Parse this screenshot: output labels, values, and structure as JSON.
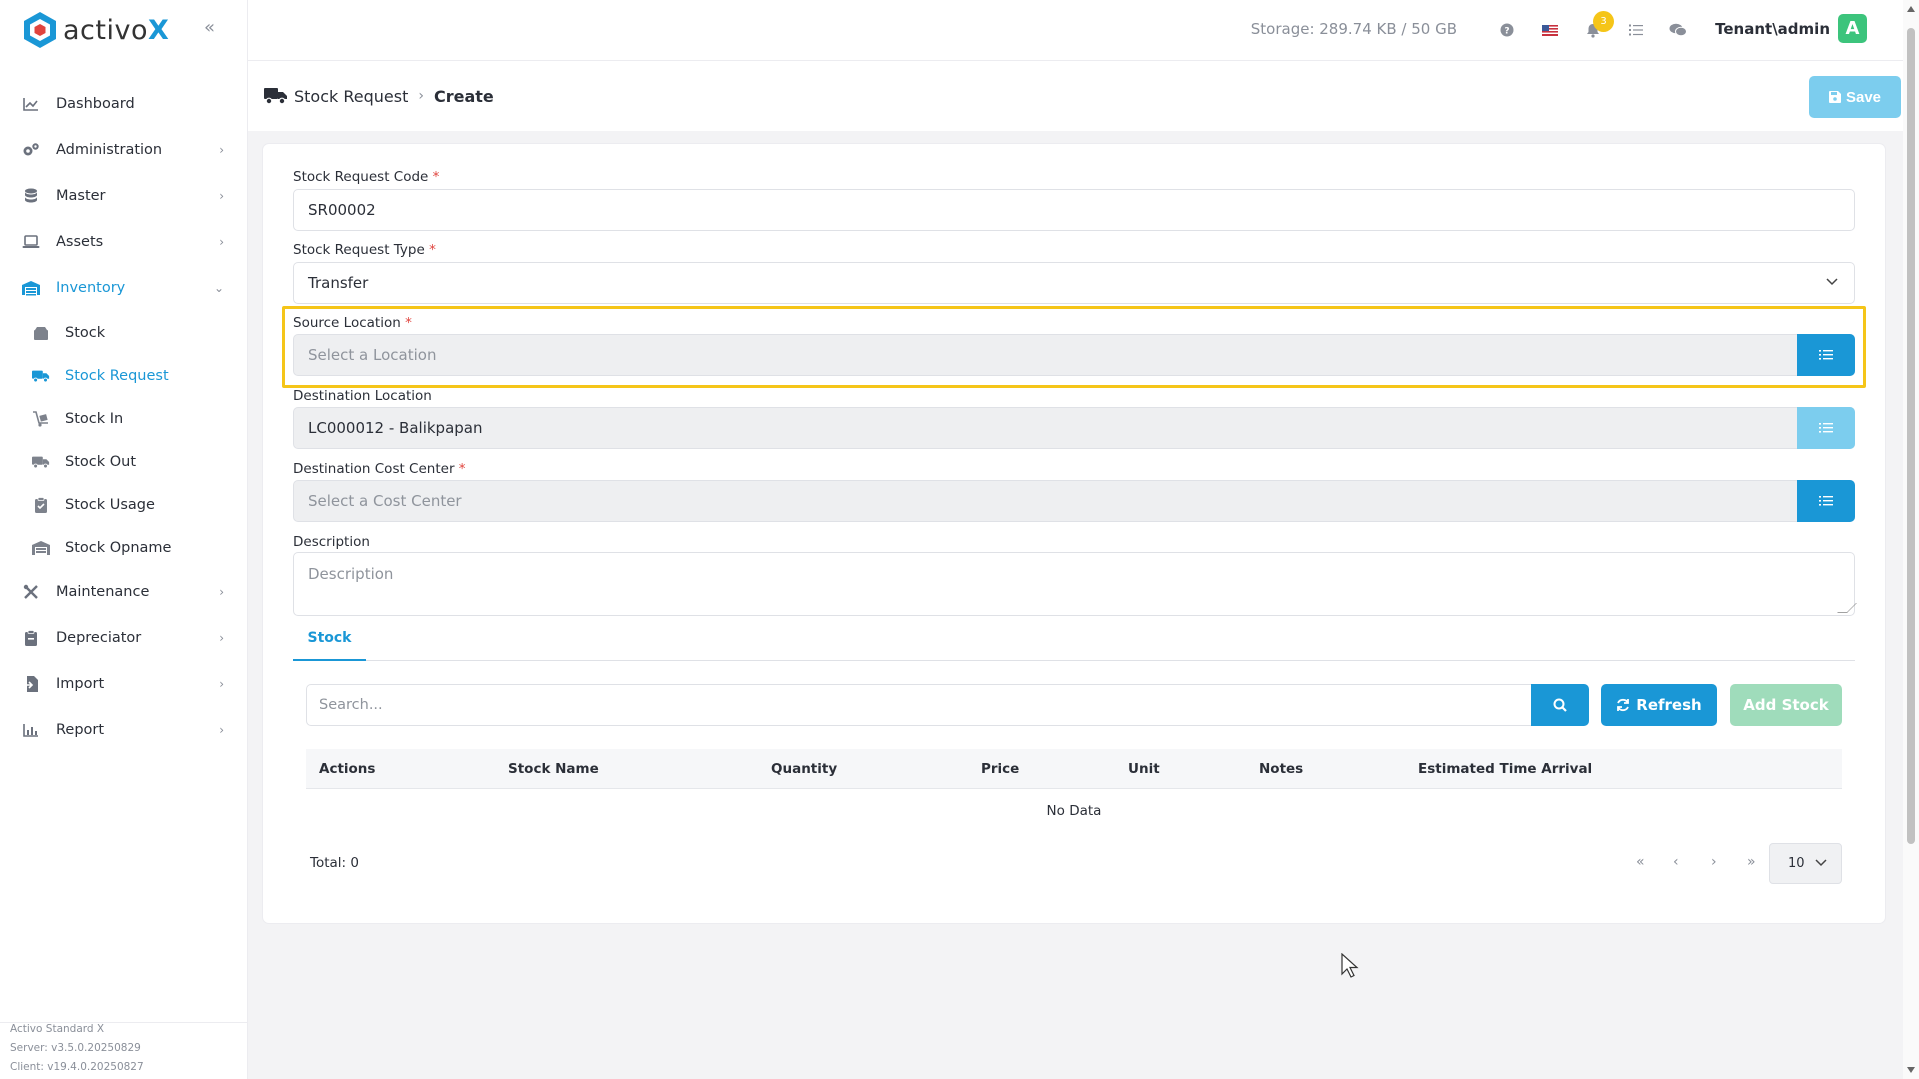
{
  "app": {
    "logo_text": "activo",
    "logo_x": "X"
  },
  "sidebar": {
    "items": [
      {
        "label": "Dashboard",
        "icon": "chart-line-icon"
      },
      {
        "label": "Administration",
        "icon": "cogs-icon",
        "has_children": true
      },
      {
        "label": "Master",
        "icon": "database-icon",
        "has_children": true
      },
      {
        "label": "Assets",
        "icon": "laptop-icon",
        "has_children": true
      },
      {
        "label": "Inventory",
        "icon": "warehouse-icon",
        "has_children": true,
        "expanded": true,
        "active": true
      },
      {
        "label": "Maintenance",
        "icon": "tools-icon",
        "has_children": true
      },
      {
        "label": "Depreciator",
        "icon": "clipboard-icon",
        "has_children": true
      },
      {
        "label": "Import",
        "icon": "file-import-icon",
        "has_children": true
      },
      {
        "label": "Report",
        "icon": "chart-bar-icon",
        "has_children": true
      }
    ],
    "inventory_children": [
      {
        "label": "Stock",
        "icon": "box-icon"
      },
      {
        "label": "Stock Request",
        "icon": "truck-icon",
        "active": true
      },
      {
        "label": "Stock In",
        "icon": "dolly-icon"
      },
      {
        "label": "Stock Out",
        "icon": "truck-loading-icon"
      },
      {
        "label": "Stock Usage",
        "icon": "clipboard-check-icon"
      },
      {
        "label": "Stock Opname",
        "icon": "warehouse-icon"
      }
    ],
    "footer": {
      "product": "Activo Standard X",
      "server": "Server: v3.5.0.20250829",
      "client": "Client: v19.4.0.20250827"
    }
  },
  "topbar": {
    "storage": "Storage: 289.74 KB / 50 GB",
    "notification_count": "3",
    "user": "Tenant\\admin",
    "avatar_letter": "A"
  },
  "page": {
    "breadcrumb_parent": "Stock Request",
    "breadcrumb_current": "Create",
    "save_label": "Save"
  },
  "form": {
    "code_label": "Stock Request Code",
    "code_value": "SR00002",
    "type_label": "Stock Request Type",
    "type_value": "Transfer",
    "source_label": "Source Location",
    "source_placeholder": "Select a Location",
    "destination_label": "Destination Location",
    "destination_value": "LC000012 - Balikpapan",
    "cost_center_label": "Destination Cost Center",
    "cost_center_placeholder": "Select a Cost Center",
    "description_label": "Description",
    "description_placeholder": "Description",
    "required_mark": "*"
  },
  "stock_tab": {
    "tab_label": "Stock",
    "search_placeholder": "Search...",
    "refresh_label": "Refresh",
    "add_label": "Add Stock",
    "columns": [
      "Actions",
      "Stock Name",
      "Quantity",
      "Price",
      "Unit",
      "Notes",
      "Estimated Time Arrival"
    ],
    "empty_text": "No Data",
    "total_text": "Total: 0",
    "page_size": "10"
  },
  "colors": {
    "primary": "#1a97d6",
    "primary_disabled": "#7ccdee",
    "success_disabled": "#9fdcbb",
    "highlight": "#f5c518",
    "avatar": "#3cc47c"
  }
}
